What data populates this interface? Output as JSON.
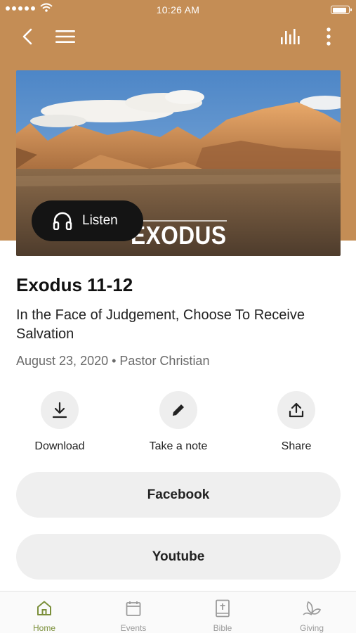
{
  "status_bar": {
    "time": "10:26 AM"
  },
  "hero": {
    "listen_label": "Listen",
    "image_title": "EXODUS"
  },
  "sermon": {
    "title": "Exodus 11-12",
    "subtitle": "In the Face of Judgement, Choose To Receive Salvation",
    "meta": "August 23, 2020 • Pastor Christian"
  },
  "actions": [
    {
      "label": "Download",
      "icon": "download-icon"
    },
    {
      "label": "Take a note",
      "icon": "pencil-icon"
    },
    {
      "label": "Share",
      "icon": "share-icon"
    }
  ],
  "links": [
    {
      "label": "Facebook"
    },
    {
      "label": "Youtube"
    }
  ],
  "tabs": [
    {
      "label": "Home",
      "icon": "home-icon",
      "active": true
    },
    {
      "label": "Events",
      "icon": "calendar-icon",
      "active": false
    },
    {
      "label": "Bible",
      "icon": "bible-icon",
      "active": false
    },
    {
      "label": "Giving",
      "icon": "giving-icon",
      "active": false
    }
  ],
  "colors": {
    "header": "#c48d55",
    "active_tab": "#7b8f3a"
  }
}
